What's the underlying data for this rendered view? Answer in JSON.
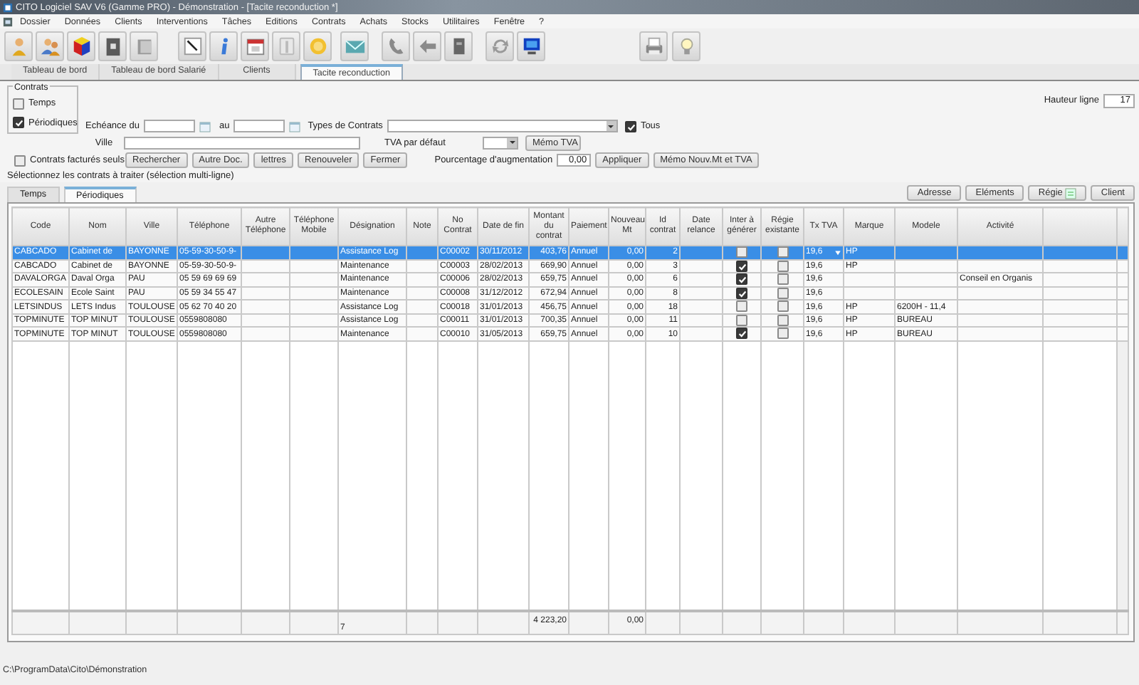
{
  "window": {
    "title": "CITO Logiciel SAV  V6 (Gamme PRO) - Démonstration - [Tacite reconduction *]"
  },
  "menu": [
    "Dossier",
    "Données",
    "Clients",
    "Interventions",
    "Tâches",
    "Editions",
    "Contrats",
    "Achats",
    "Stocks",
    "Utilitaires",
    "Fenêtre",
    "?"
  ],
  "tabs": [
    {
      "label": "Tableau de bord",
      "selected": false
    },
    {
      "label": "Tableau de bord Salarié",
      "selected": false
    },
    {
      "label": "Clients",
      "selected": false
    },
    {
      "label": "Tacite reconduction",
      "selected": true
    }
  ],
  "form": {
    "group_title": "Contrats",
    "group_options": [
      {
        "label": "Temps",
        "checked": false
      },
      {
        "label": "Périodiques",
        "checked": true
      }
    ],
    "echeance_label": "Echéance du",
    "au_label": "au",
    "types_label": "Types de Contrats",
    "tous": {
      "label": "Tous",
      "checked": true
    },
    "ville_label": "Ville",
    "tva_label": "TVA par défaut",
    "memo_tva_button": "Mémo TVA",
    "factures_seuls": {
      "label": "Contrats facturés seuls",
      "checked": false
    },
    "action_buttons": [
      "Rechercher",
      "Autre Doc.",
      "lettres",
      "Renouveler",
      "Fermer"
    ],
    "pourcentage_label": "Pourcentage d'augmentation",
    "pourcentage_value": "0,00",
    "appliquer_button": "Appliquer",
    "memo_nouv_button": "Mémo Nouv.Mt et TVA",
    "hauteur_label": "Hauteur ligne",
    "hauteur_value": "17",
    "hint": "Sélectionnez les contrats à traiter (sélection multi-ligne)"
  },
  "sub_tabs": [
    {
      "label": "Temps",
      "selected": false
    },
    {
      "label": "Périodiques",
      "selected": true
    }
  ],
  "grid_buttons": [
    {
      "label": "Adresse",
      "kind": "plain"
    },
    {
      "label": "Eléments",
      "kind": "plain"
    },
    {
      "label": "Régie",
      "kind": "icon"
    },
    {
      "label": "Client",
      "kind": "plain"
    }
  ],
  "table": {
    "columns": [
      {
        "label": "Code",
        "kind": "text"
      },
      {
        "label": "Nom",
        "kind": "text"
      },
      {
        "label": "Ville",
        "kind": "text"
      },
      {
        "label": "Téléphone",
        "kind": "text"
      },
      {
        "label": "Autre Téléphone",
        "kind": "text"
      },
      {
        "label": "Téléphone Mobile",
        "kind": "text"
      },
      {
        "label": "Désignation",
        "kind": "text",
        "total": "7"
      },
      {
        "label": "Note",
        "kind": "text"
      },
      {
        "label": "No Contrat",
        "kind": "text"
      },
      {
        "label": "Date de fin",
        "kind": "text"
      },
      {
        "label": "Montant du contrat",
        "kind": "number",
        "total": "4 223,20"
      },
      {
        "label": "Paiement",
        "kind": "text"
      },
      {
        "label": "Nouveau Mt",
        "kind": "number",
        "total": "0,00"
      },
      {
        "label": "Id contrat",
        "kind": "number"
      },
      {
        "label": "Date relance",
        "kind": "text"
      },
      {
        "label": "Inter à générer",
        "kind": "check"
      },
      {
        "label": "Régie existante",
        "kind": "check"
      },
      {
        "label": "Tx TVA",
        "kind": "combo"
      },
      {
        "label": "Marque",
        "kind": "text"
      },
      {
        "label": "Modele",
        "kind": "text"
      },
      {
        "label": "Activité",
        "kind": "text"
      }
    ],
    "rows": [
      {
        "selected": true,
        "code": "CABCADO",
        "nom": "Cabinet de",
        "ville": "BAYONNE",
        "telephone": "05-59-30-50-9-",
        "designation": "Assistance Log",
        "no_contrat": "C00002",
        "date_fin": "30/11/2012",
        "montant": "403,76",
        "paiement": "Annuel",
        "nouveau_mt": "0,00",
        "id_contrat": "2",
        "inter_a_generer": false,
        "regie_existante": false,
        "tx_tva": "19,6",
        "marque": "HP"
      },
      {
        "selected": false,
        "code": "CABCADO",
        "nom": "Cabinet de",
        "ville": "BAYONNE",
        "telephone": "05-59-30-50-9-",
        "designation": "Maintenance",
        "no_contrat": "C00003",
        "date_fin": "28/02/2013",
        "montant": "669,90",
        "paiement": "Annuel",
        "nouveau_mt": "0,00",
        "id_contrat": "3",
        "inter_a_generer": true,
        "regie_existante": false,
        "tx_tva": "19,6",
        "marque": "HP"
      },
      {
        "selected": false,
        "code": "DAVALORGA",
        "nom": "Daval Orga",
        "ville": "PAU",
        "telephone": "05 59 69 69 69",
        "designation": "Maintenance",
        "no_contrat": "C00006",
        "date_fin": "28/02/2013",
        "montant": "659,75",
        "paiement": "Annuel",
        "nouveau_mt": "0,00",
        "id_contrat": "6",
        "inter_a_generer": true,
        "regie_existante": false,
        "tx_tva": "19,6",
        "activite": "Conseil en Organis"
      },
      {
        "selected": false,
        "code": "ECOLESAIN",
        "nom": "Ecole Saint",
        "ville": "PAU",
        "telephone": "05 59 34 55 47",
        "designation": "Maintenance",
        "no_contrat": "C00008",
        "date_fin": "31/12/2012",
        "montant": "672,94",
        "paiement": "Annuel",
        "nouveau_mt": "0,00",
        "id_contrat": "8",
        "inter_a_generer": true,
        "regie_existante": false,
        "tx_tva": "19,6"
      },
      {
        "selected": false,
        "code": "LETSINDUS",
        "nom": "LETS Indus",
        "ville": "TOULOUSE",
        "telephone": "05 62 70 40 20",
        "designation": "Assistance Log",
        "no_contrat": "C00018",
        "date_fin": "31/01/2013",
        "montant": "456,75",
        "paiement": "Annuel",
        "nouveau_mt": "0,00",
        "id_contrat": "18",
        "inter_a_generer": false,
        "regie_existante": false,
        "tx_tva": "19,6",
        "marque": "HP",
        "modele": "6200H - 11,4"
      },
      {
        "selected": false,
        "code": "TOPMINUTE",
        "nom": "TOP MINUT",
        "ville": "TOULOUSE",
        "telephone": "0559808080",
        "designation": "Assistance Log",
        "no_contrat": "C00011",
        "date_fin": "31/01/2013",
        "montant": "700,35",
        "paiement": "Annuel",
        "nouveau_mt": "0,00",
        "id_contrat": "11",
        "inter_a_generer": false,
        "regie_existante": false,
        "tx_tva": "19,6",
        "marque": "HP",
        "modele": "BUREAU"
      },
      {
        "selected": false,
        "code": "TOPMINUTE",
        "nom": "TOP MINUT",
        "ville": "TOULOUSE",
        "telephone": "0559808080",
        "designation": "Maintenance",
        "no_contrat": "C00010",
        "date_fin": "31/05/2013",
        "montant": "659,75",
        "paiement": "Annuel",
        "nouveau_mt": "0,00",
        "id_contrat": "10",
        "inter_a_generer": true,
        "regie_existante": false,
        "tx_tva": "19,6",
        "marque": "HP",
        "modele": "BUREAU"
      }
    ]
  },
  "status_bar": "C:\\ProgramData\\Cito\\Démonstration"
}
